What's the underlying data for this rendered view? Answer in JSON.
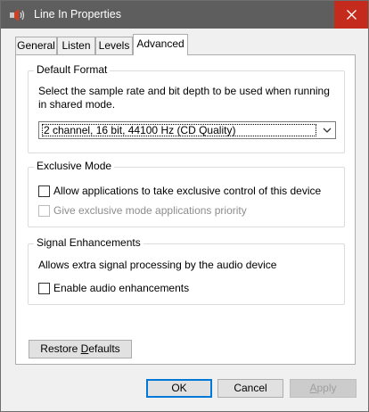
{
  "window": {
    "title": "Line In Properties",
    "close_icon": "close-icon",
    "app_icon": "speaker-icon"
  },
  "tabs": [
    {
      "label": "General",
      "active": false
    },
    {
      "label": "Listen",
      "active": false
    },
    {
      "label": "Levels",
      "active": false
    },
    {
      "label": "Advanced",
      "active": true
    }
  ],
  "default_format": {
    "title": "Default Format",
    "description_line1": "Select the sample rate and bit depth to be used when running",
    "description_line2": "in shared mode.",
    "selected_value": "2 channel, 16 bit, 44100 Hz (CD Quality)",
    "dropdown_icon": "chevron-down-icon"
  },
  "exclusive_mode": {
    "title": "Exclusive Mode",
    "allow_label": "Allow applications to take exclusive control of this device",
    "allow_checked": false,
    "priority_label": "Give exclusive mode applications priority",
    "priority_checked": false,
    "priority_enabled": false
  },
  "signal_enhancements": {
    "title": "Signal Enhancements",
    "description": "Allows extra signal processing by the audio device",
    "enable_label": "Enable audio enhancements",
    "enable_checked": false
  },
  "restore_defaults": {
    "label_pre": "Restore ",
    "label_accel": "D",
    "label_post": "efaults"
  },
  "buttons": {
    "ok": "OK",
    "cancel": "Cancel",
    "apply_pre": "",
    "apply_accel": "A",
    "apply_post": "pply"
  },
  "colors": {
    "titlebar": "#5e5e5e",
    "close_hover": "#c42b1c",
    "focus_accent": "#0078d7",
    "dialog_bg": "#f0f0f0"
  }
}
